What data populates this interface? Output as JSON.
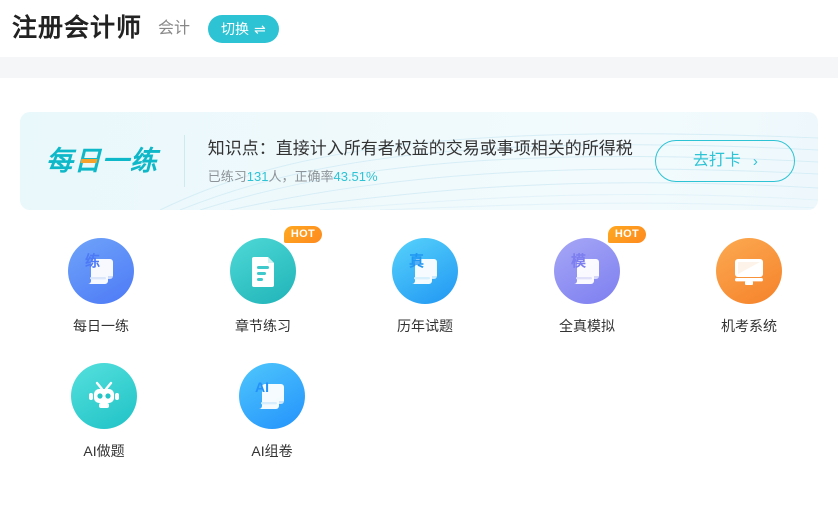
{
  "header": {
    "title": "注册会计师",
    "subject": "会计",
    "switch_label": "切换",
    "switch_icon": "swap-arrows-icon",
    "switch_glyph": "⇌",
    "accent_color": "#2ec3d4"
  },
  "daily_banner": {
    "logo_text": "每日一练",
    "logo_color": "#0fb8c8",
    "logo_accent_color": "#f7a32b",
    "knowledge_point": "知识点：直接计入所有者权益的交易或事项相关的所得税",
    "stats_prefix": "已练习",
    "practiced_count": "131",
    "stats_middle": "人，正确率",
    "accuracy": "43.51%",
    "button_label": "去打卡",
    "button_arrow": "›",
    "button_color": "#2ec3d4"
  },
  "grid": {
    "rows": [
      [
        {
          "label": "每日一练",
          "icon": "scroll-practice-icon",
          "glyph": "练",
          "style": "g-blue",
          "badge": ""
        },
        {
          "label": "章节练习",
          "icon": "document-lines-icon",
          "glyph": "",
          "style": "g-teal",
          "badge": "HOT"
        },
        {
          "label": "历年试题",
          "icon": "book-real-icon",
          "glyph": "真",
          "style": "g-cyan",
          "badge": ""
        },
        {
          "label": "全真模拟",
          "icon": "scroll-mock-icon",
          "glyph": "模",
          "style": "g-purple",
          "badge": "HOT"
        },
        {
          "label": "机考系统",
          "icon": "monitor-icon",
          "glyph": "",
          "style": "g-orange",
          "badge": ""
        }
      ],
      [
        {
          "label": "AI做题",
          "icon": "robot-head-icon",
          "glyph": "",
          "style": "g-aqua",
          "badge": ""
        },
        {
          "label": "AI组卷",
          "icon": "scroll-ai-icon",
          "glyph": "AI",
          "style": "g-sky",
          "badge": ""
        }
      ]
    ]
  }
}
